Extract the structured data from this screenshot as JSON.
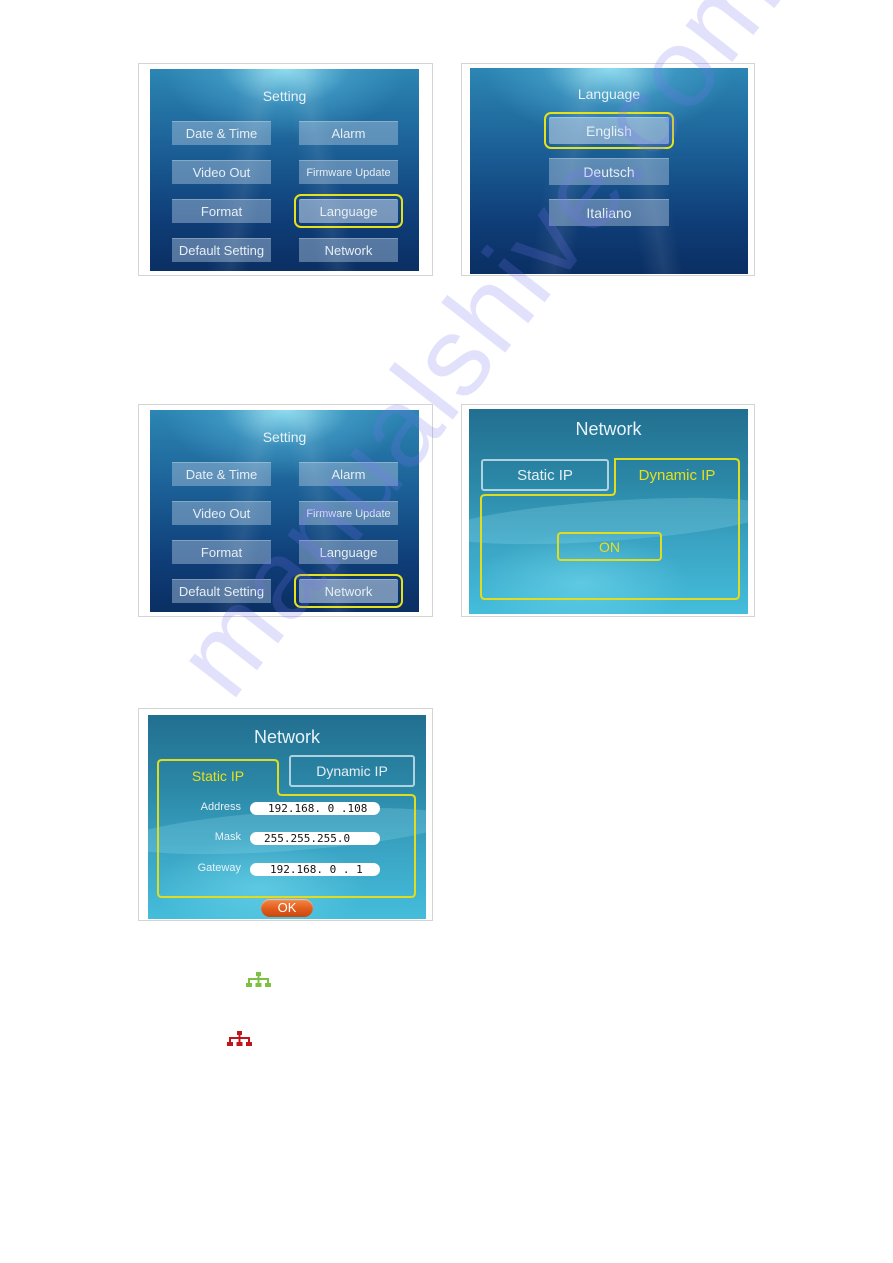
{
  "screens": {
    "setting_language": {
      "title": "Setting",
      "buttons": [
        "Date & Time",
        "Alarm",
        "Video Out",
        "Firmware Update",
        "Format",
        "Language",
        "Default Setting",
        "Network"
      ],
      "selected": "Language"
    },
    "language": {
      "title": "Language",
      "options": [
        "English",
        "Deutsch",
        "Italiano"
      ],
      "selected": "English"
    },
    "setting_network": {
      "title": "Setting",
      "buttons": [
        "Date & Time",
        "Alarm",
        "Video Out",
        "Firmware Update",
        "Format",
        "Language",
        "Default Setting",
        "Network"
      ],
      "selected": "Network"
    },
    "network_dynamic": {
      "title": "Network",
      "tabs": [
        "Static IP",
        "Dynamic IP"
      ],
      "active_tab": "Dynamic IP",
      "toggle_value": "ON"
    },
    "network_static": {
      "title": "Network",
      "tabs": [
        "Static IP",
        "Dynamic IP"
      ],
      "active_tab": "Static IP",
      "fields": [
        {
          "label": "Address",
          "value": "192.168. 0 .108"
        },
        {
          "label": "Mask",
          "value": "255.255.255.0"
        },
        {
          "label": "Gateway",
          "value": "192.168. 0 . 1"
        }
      ],
      "ok_label": "OK"
    }
  },
  "status_icons": [
    {
      "name": "network-connected-icon",
      "color": "#7cc142"
    },
    {
      "name": "network-disconnected-icon",
      "color": "#c0151b"
    }
  ],
  "colors": {
    "highlight": "#e6e11c",
    "ok_button": "#e25c1b"
  },
  "watermark": "manualshive.com"
}
